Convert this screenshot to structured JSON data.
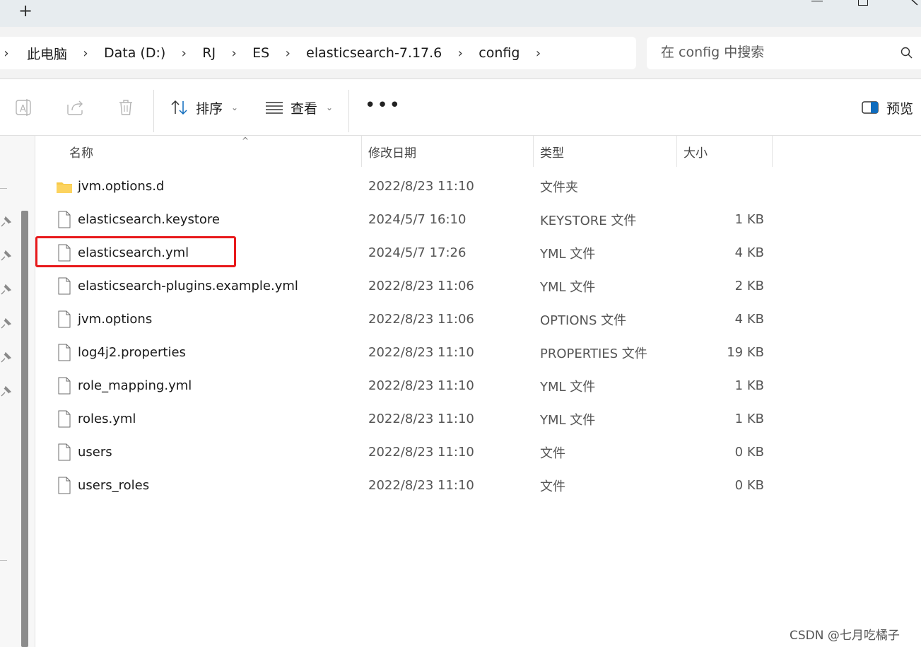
{
  "titlebar": {
    "new_tab_label": "+"
  },
  "breadcrumb": {
    "items": [
      "此电脑",
      "Data (D:)",
      "RJ",
      "ES",
      "elasticsearch-7.17.6",
      "config"
    ],
    "separator": "›"
  },
  "search": {
    "placeholder": "在 config 中搜索"
  },
  "toolbar": {
    "sort_label": "排序",
    "view_label": "查看",
    "more_label": "•••",
    "preview_label": "预览"
  },
  "columns": {
    "name": "名称",
    "date": "修改日期",
    "type": "类型",
    "size": "大小"
  },
  "files": [
    {
      "name": "jvm.options.d",
      "date": "2022/8/23 11:10",
      "type": "文件夹",
      "size": "",
      "icon": "folder-icon"
    },
    {
      "name": "elasticsearch.keystore",
      "date": "2024/5/7 16:10",
      "type": "KEYSTORE 文件",
      "size": "1 KB",
      "icon": "file-icon"
    },
    {
      "name": "elasticsearch.yml",
      "date": "2024/5/7 17:26",
      "type": "YML 文件",
      "size": "4 KB",
      "icon": "file-icon",
      "highlighted": true
    },
    {
      "name": "elasticsearch-plugins.example.yml",
      "date": "2022/8/23 11:06",
      "type": "YML 文件",
      "size": "2 KB",
      "icon": "file-icon"
    },
    {
      "name": "jvm.options",
      "date": "2022/8/23 11:06",
      "type": "OPTIONS 文件",
      "size": "4 KB",
      "icon": "file-icon"
    },
    {
      "name": "log4j2.properties",
      "date": "2022/8/23 11:10",
      "type": "PROPERTIES 文件",
      "size": "19 KB",
      "icon": "file-icon"
    },
    {
      "name": "role_mapping.yml",
      "date": "2022/8/23 11:10",
      "type": "YML 文件",
      "size": "1 KB",
      "icon": "file-icon"
    },
    {
      "name": "roles.yml",
      "date": "2022/8/23 11:10",
      "type": "YML 文件",
      "size": "1 KB",
      "icon": "file-icon"
    },
    {
      "name": "users",
      "date": "2022/8/23 11:10",
      "type": "文件",
      "size": "0 KB",
      "icon": "file-icon"
    },
    {
      "name": "users_roles",
      "date": "2022/8/23 11:10",
      "type": "文件",
      "size": "0 KB",
      "icon": "file-icon"
    }
  ],
  "colors": {
    "highlight_border": "#e8191b",
    "folder": "#f7c948",
    "accent": "#0f6cbd"
  },
  "watermark": "CSDN @七月吃橘子"
}
